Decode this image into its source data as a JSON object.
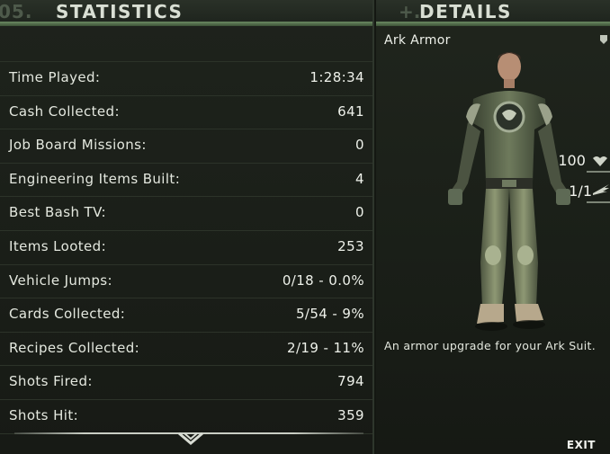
{
  "stats": {
    "number": "05.",
    "title": "STATISTICS",
    "rows": [
      {
        "label": "Time Played:",
        "value": "1:28:34"
      },
      {
        "label": "Cash Collected:",
        "value": "641"
      },
      {
        "label": "Job Board Missions:",
        "value": "0"
      },
      {
        "label": "Engineering Items Built:",
        "value": "4"
      },
      {
        "label": "Best Bash TV:",
        "value": "0"
      },
      {
        "label": "Items Looted:",
        "value": "253"
      },
      {
        "label": "Vehicle Jumps:",
        "value": "0/18 - 0.0%"
      },
      {
        "label": "Cards Collected:",
        "value": "5/54 - 9%"
      },
      {
        "label": "Recipes Collected:",
        "value": "2/19 - 11%"
      },
      {
        "label": "Shots Fired:",
        "value": "794"
      },
      {
        "label": "Shots Hit:",
        "value": "359"
      }
    ],
    "scroll_icon": "chevron-down-icon"
  },
  "details": {
    "plus": "+.",
    "title": "DETAILS",
    "item_name": "Ark Armor",
    "armor_value": "100",
    "armor_icon": "armor-icon",
    "slots_value": "1/1",
    "slots_icon": "wing-icon",
    "description": "An armor upgrade for your Ark Suit.",
    "exit_label": "EXIT"
  },
  "colors": {
    "accent_green": "#6b8a62",
    "panel_bg": "#1a1e18",
    "text": "#e6e9e1"
  }
}
